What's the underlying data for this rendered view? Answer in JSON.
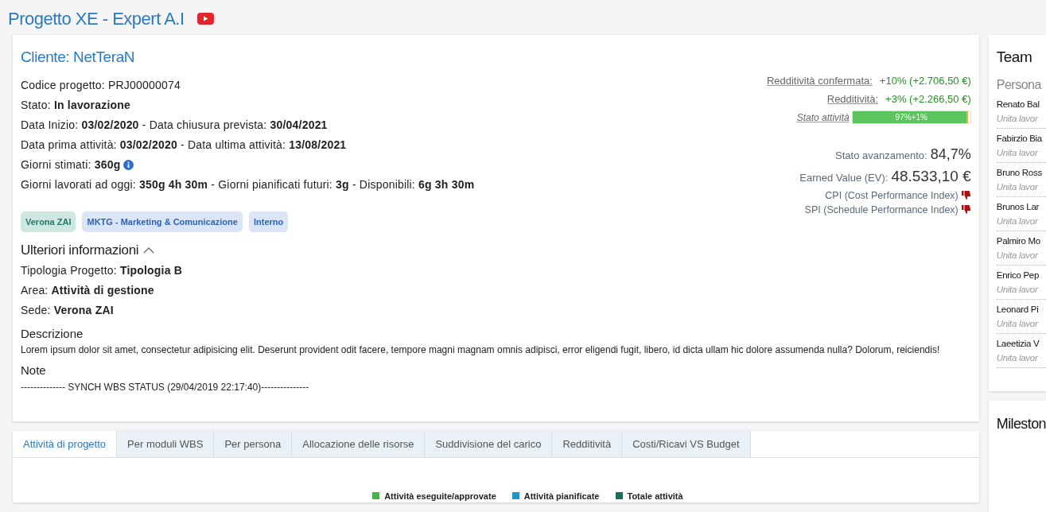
{
  "page_title": "Progetto XE - Expert A.I",
  "project": {
    "client": "Cliente: NetTeraN",
    "lines": [
      "Codice progetto: PRJ00000074",
      "Stato: **In lavorazione**",
      "Data Inizio: **03/02/2020** - Data chiusura prevista: **30/04/2021**",
      "Data prima attività: **03/02/2020** - Data ultima attività: **13/08/2021**",
      "Giorni stimati: **360g**",
      "Giorni lavorati ad oggi: **350g 4h 30m** - Giorni pianificati futuri: **3g** - Disponibili: **6g 3h 30m**"
    ],
    "tags": [
      {
        "label": "Verona ZAI",
        "color": "#1f7a68"
      },
      {
        "label": "MKTG - Marketing & Comunicazione",
        "color": "#2a64b8"
      },
      {
        "label": "Interno",
        "color": "#2a64b8"
      }
    ],
    "more_info": {
      "title": "Ulteriori informazioni",
      "expanded": true,
      "lines": [
        "Tipologia Progetto: **Tipologia B**",
        "Area: **Attività di gestione**",
        "Sede: **Verona ZAI**"
      ]
    },
    "description": {
      "title": "Descrizione",
      "text": "Lorem ipsum dolor sit amet, consectetur adipisicing elit. Deserunt provident odit facere, tempore magni magnam omnis adipisci, error eligendi fugit, libero, id dicta ullam hic dolore assumenda nulla? Dolorum, reiciendis!"
    },
    "note": {
      "title": "Note",
      "text": "-------------- SYNCH WBS STATUS (29/04/2019 22:17:40)---------------"
    }
  },
  "metrics": {
    "profit_confirmed": {
      "label": "Redditività confermata:",
      "value": "+10% (+2.706,50 €)"
    },
    "profit": {
      "label": "Redditività:",
      "value": "+3% (+2.266,50 €)"
    },
    "activity_status": {
      "label": "Stato attività",
      "text": "97%+1%",
      "segments": [
        {
          "kind": "done",
          "level": 0.97
        },
        {
          "kind": "extra",
          "level": 0.01
        }
      ]
    },
    "progress": {
      "label": "Stato avanzamento:",
      "value": "84,7%"
    },
    "earned_value": {
      "label": "Earned Value (EV):",
      "value": "48.533,10 €"
    },
    "indices": [
      {
        "label": "CPI (Cost Performance Index)",
        "good": false
      },
      {
        "label": "SPI (Schedule Performance Index)",
        "good": false
      }
    ]
  },
  "team": {
    "title": "Team",
    "column": "Persona",
    "members": [
      {
        "name": "Renato Bal",
        "role": "Unita lavor"
      },
      {
        "name": "Fabirzio Bia",
        "role": "Unita lavor"
      },
      {
        "name": "Bruno Ross",
        "role": "Unita lavor"
      },
      {
        "name": "Brunos Lar",
        "role": "Unita lavor"
      },
      {
        "name": "Palmiro Mo",
        "role": "Unita lavor"
      },
      {
        "name": "Enrico Pep",
        "role": "Unita lavor"
      },
      {
        "name": "Leonard Pi",
        "role": "Unita lavor"
      },
      {
        "name": "Laeetizia V",
        "role": "Unita lavor"
      }
    ]
  },
  "milestones": {
    "title": "Mileston"
  },
  "tabs": [
    {
      "label": "Attività di progetto",
      "selected": true
    },
    {
      "label": "Per moduli WBS",
      "selected": false
    },
    {
      "label": "Per persona",
      "selected": false
    },
    {
      "label": "Allocazione delle risorse",
      "selected": false
    },
    {
      "label": "Suddivisione del carico",
      "selected": false
    },
    {
      "label": "Redditività",
      "selected": false
    },
    {
      "label": "Costi/Ricavi VS Budget",
      "selected": false
    }
  ],
  "legend": [
    {
      "label": "Attività eseguite/approvate",
      "color": "#4caf50"
    },
    {
      "label": "Attività pianificate",
      "color": "#2196c8"
    },
    {
      "label": "Totale attività",
      "color": "#1f6b5a"
    }
  ]
}
